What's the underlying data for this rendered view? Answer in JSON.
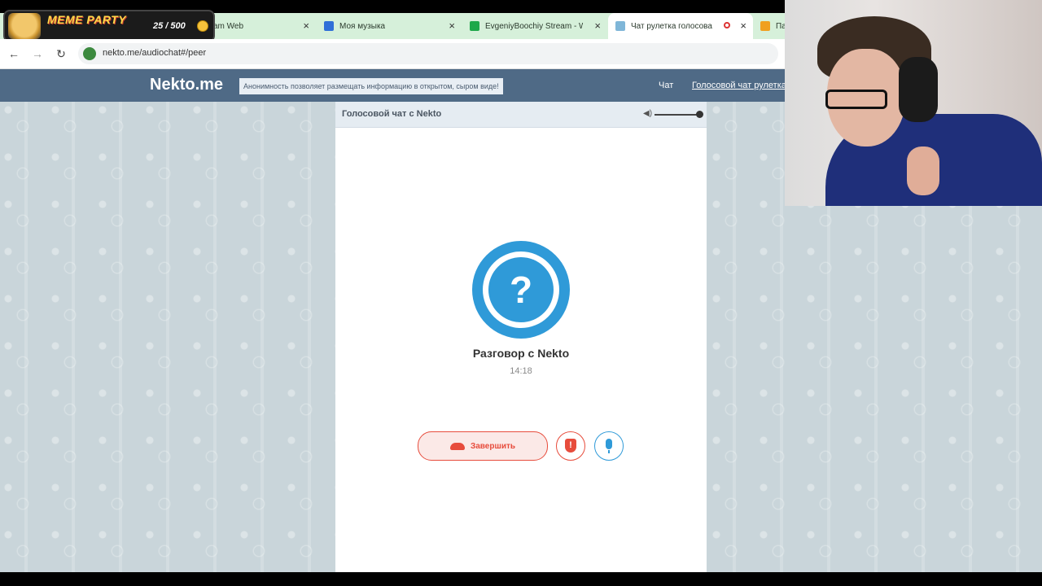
{
  "browser": {
    "tabs": [
      {
        "label": "am Web",
        "active": false
      },
      {
        "label": "Моя музыка",
        "active": false
      },
      {
        "label": "EvgeniyBoochiy Stream - Wa",
        "active": false
      },
      {
        "label": "Чат рулетка голосовая ·",
        "active": true
      },
      {
        "label": "Па",
        "active": false
      }
    ],
    "url": "nekto.me/audiochat#/peer"
  },
  "overlay": {
    "title": "MEME PARTY",
    "count": "25 / 500"
  },
  "site": {
    "logo": "Nekto.me",
    "slogan": "Анонимность позволяет размещать информацию в открытом, сыром виде!",
    "nav": {
      "chat": "Чат",
      "voice": "Голосовой чат рулетка"
    }
  },
  "panel": {
    "title": "Голосовой чат с Nekto",
    "avatar_glyph": "?",
    "conversation_title": "Разговор с Nekto",
    "timer": "14:18",
    "end_label": "Завершить",
    "report_glyph": "!",
    "volume_level": 1.0
  },
  "colors": {
    "header_bg": "#4f6a86",
    "accent_blue": "#2f9ad8",
    "danger_red": "#e74c3c",
    "tabstrip_bg": "#d6f0da"
  },
  "icons": [
    "back-icon",
    "forward-icon",
    "reload-icon",
    "site-info-icon",
    "volume-icon",
    "phone-icon",
    "shield-icon",
    "mic-icon"
  ]
}
